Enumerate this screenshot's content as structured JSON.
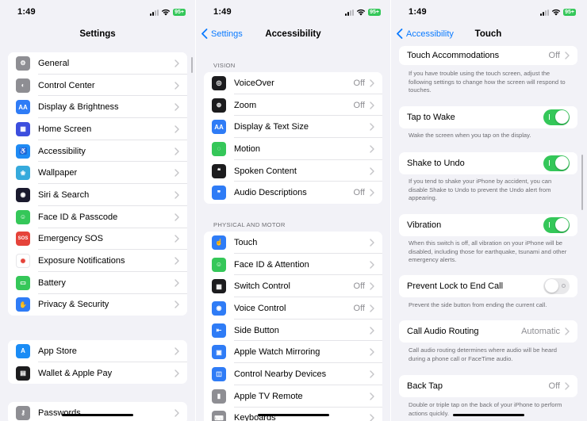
{
  "status": {
    "time": "1:49",
    "battery": "95+"
  },
  "settings": {
    "title": "Settings",
    "group1": [
      {
        "label": "General",
        "icon": "gear-icon",
        "color": "#8e8e93"
      },
      {
        "label": "Control Center",
        "icon": "toggles-icon",
        "color": "#8e8e93"
      },
      {
        "label": "Display & Brightness",
        "icon": "aa-icon",
        "color": "#2f7cf6"
      },
      {
        "label": "Home Screen",
        "icon": "grid-icon",
        "color": "#3c4ede"
      },
      {
        "label": "Accessibility",
        "icon": "accessibility-icon",
        "color": "#1f8bf4"
      },
      {
        "label": "Wallpaper",
        "icon": "flower-icon",
        "color": "#36aadc"
      },
      {
        "label": "Siri & Search",
        "icon": "siri-icon",
        "color": "#1a1a2e"
      },
      {
        "label": "Face ID & Passcode",
        "icon": "face-id-icon",
        "color": "#35c759"
      },
      {
        "label": "Emergency SOS",
        "icon": "sos-icon",
        "color": "#e5433a"
      },
      {
        "label": "Exposure Notifications",
        "icon": "exposure-icon",
        "color": "#ffffff"
      },
      {
        "label": "Battery",
        "icon": "battery-icon",
        "color": "#35c759"
      },
      {
        "label": "Privacy & Security",
        "icon": "hand-icon",
        "color": "#2f7cf6"
      }
    ],
    "group2": [
      {
        "label": "App Store",
        "icon": "app-store-icon",
        "color": "#1a8cf5"
      },
      {
        "label": "Wallet & Apple Pay",
        "icon": "wallet-icon",
        "color": "#1c1c1e"
      }
    ],
    "group3": [
      {
        "label": "Passwords",
        "icon": "key-icon",
        "color": "#8e8e93"
      }
    ]
  },
  "accessibility": {
    "back_label": "Settings",
    "title": "Accessibility",
    "vision_header": "VISION",
    "vision": [
      {
        "label": "VoiceOver",
        "value": "Off",
        "icon": "voiceover-icon",
        "color": "#1c1c1e"
      },
      {
        "label": "Zoom",
        "value": "Off",
        "icon": "zoom-icon",
        "color": "#1c1c1e"
      },
      {
        "label": "Display & Text Size",
        "value": "",
        "icon": "aa-icon",
        "color": "#2f7cf6"
      },
      {
        "label": "Motion",
        "value": "",
        "icon": "motion-icon",
        "color": "#35c759"
      },
      {
        "label": "Spoken Content",
        "value": "",
        "icon": "speech-icon",
        "color": "#1c1c1e"
      },
      {
        "label": "Audio Descriptions",
        "value": "Off",
        "icon": "audio-description-icon",
        "color": "#2f7cf6"
      }
    ],
    "motor_header": "PHYSICAL AND MOTOR",
    "motor": [
      {
        "label": "Touch",
        "value": "",
        "icon": "touch-icon",
        "color": "#2f7cf6"
      },
      {
        "label": "Face ID & Attention",
        "value": "",
        "icon": "face-id-icon",
        "color": "#35c759"
      },
      {
        "label": "Switch Control",
        "value": "Off",
        "icon": "switch-control-icon",
        "color": "#1c1c1e"
      },
      {
        "label": "Voice Control",
        "value": "Off",
        "icon": "voice-control-icon",
        "color": "#2f7cf6"
      },
      {
        "label": "Side Button",
        "value": "",
        "icon": "side-button-icon",
        "color": "#2f7cf6"
      },
      {
        "label": "Apple Watch Mirroring",
        "value": "",
        "icon": "watch-mirroring-icon",
        "color": "#2f7cf6"
      },
      {
        "label": "Control Nearby Devices",
        "value": "",
        "icon": "nearby-devices-icon",
        "color": "#2f7cf6"
      },
      {
        "label": "Apple TV Remote",
        "value": "",
        "icon": "remote-icon",
        "color": "#8e8e93"
      },
      {
        "label": "Keyboards",
        "value": "",
        "icon": "keyboard-icon",
        "color": "#8e8e93"
      }
    ]
  },
  "touch": {
    "back_label": "Accessibility",
    "title": "Touch",
    "touch_accommodations": {
      "label": "Touch Accommodations",
      "value": "Off"
    },
    "touch_accommodations_note": "If you have trouble using the touch screen, adjust the following settings to change how the screen will respond to touches.",
    "tap_to_wake": {
      "label": "Tap to Wake",
      "on": true
    },
    "tap_to_wake_note": "Wake the screen when you tap on the display.",
    "shake_to_undo": {
      "label": "Shake to Undo",
      "on": true
    },
    "shake_to_undo_note": "If you tend to shake your iPhone by accident, you can disable Shake to Undo to prevent the Undo alert from appearing.",
    "vibration": {
      "label": "Vibration",
      "on": true
    },
    "vibration_note": "When this switch is off, all vibration on your iPhone will be disabled, including those for earthquake, tsunami and other emergency alerts.",
    "prevent_lock": {
      "label": "Prevent Lock to End Call",
      "on": false
    },
    "prevent_lock_note": "Prevent the side button from ending the current call.",
    "call_audio_routing": {
      "label": "Call Audio Routing",
      "value": "Automatic"
    },
    "call_audio_routing_note": "Call audio routing determines where audio will be heard during a phone call or FaceTime audio.",
    "back_tap": {
      "label": "Back Tap",
      "value": "Off"
    },
    "back_tap_note": "Double or triple tap on the back of your iPhone to perform actions quickly."
  }
}
